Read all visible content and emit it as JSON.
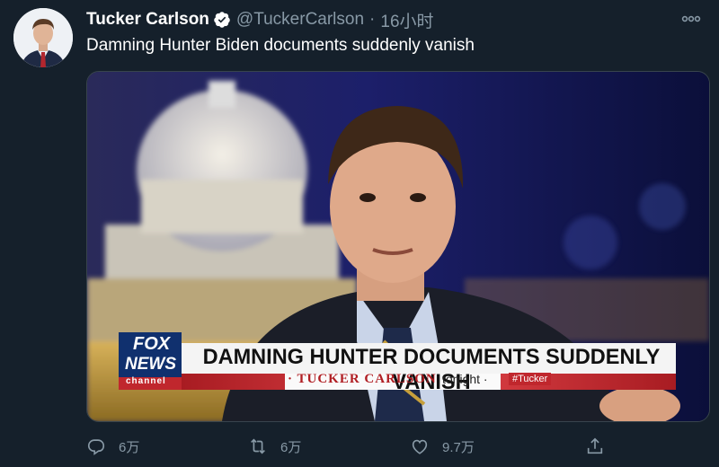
{
  "tweet": {
    "author_name": "Tucker Carlson",
    "handle": "@TuckerCarlson",
    "separator": "·",
    "time": "16小时",
    "text": "Damning Hunter Biden documents suddenly vanish",
    "more_icon": "more-horizontal-icon",
    "verified_icon": "verified-badge-icon"
  },
  "media": {
    "chyron_headline": "DAMNING HUNTER DOCUMENTS SUDDENLY VANISH",
    "chyron_show": "· TUCKER CARLSON",
    "chyron_tonight": "tonight ·",
    "chyron_hashtag": "#Tucker",
    "logo_line1": "FOX",
    "logo_line2": "NEWS",
    "logo_line3": "channel"
  },
  "actions": {
    "reply": {
      "icon": "reply-icon",
      "count": "6万"
    },
    "retweet": {
      "icon": "retweet-icon",
      "count": "6万"
    },
    "like": {
      "icon": "heart-icon",
      "count": "9.7万"
    },
    "share": {
      "icon": "share-icon"
    }
  },
  "colors": {
    "background": "#15202b",
    "secondary_text": "#8899a6",
    "verified": "#ffffff",
    "chyron_red": "#c0272d"
  }
}
